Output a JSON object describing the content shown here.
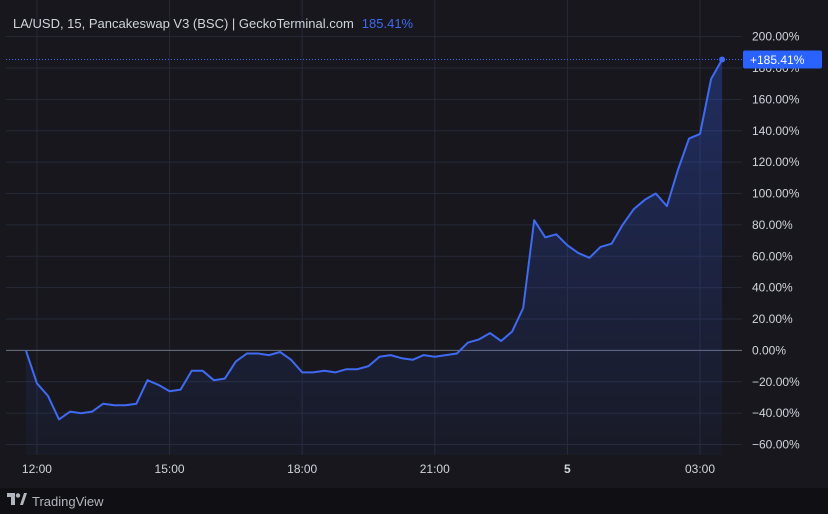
{
  "header": {
    "title": "LA/USD, 15, Pancakeswap V3 (BSC) | GeckoTerminal.com",
    "change": "185.41%"
  },
  "footer": {
    "brand": "TradingView",
    "logo_icon": "tradingview-logo-icon"
  },
  "colors": {
    "background": "#17171d",
    "line": "#3f6af2",
    "grid": "#262a38",
    "text": "#d1d4dc",
    "badge": "#2962ff"
  },
  "chart_data": {
    "type": "area",
    "title": "LA/USD, 15, Pancakeswap V3 (BSC) | GeckoTerminal.com",
    "xlabel": "",
    "ylabel": "",
    "y_unit": "%",
    "ylim": [
      -65,
      205
    ],
    "y_ticks": [
      "200.00%",
      "180.00%",
      "160.00%",
      "140.00%",
      "120.00%",
      "100.00%",
      "80.00%",
      "60.00%",
      "40.00%",
      "20.00%",
      "0.00%",
      "−20.00%",
      "−40.00%",
      "−60.00%"
    ],
    "y_tick_values": [
      200,
      180,
      160,
      140,
      120,
      100,
      80,
      60,
      40,
      20,
      0,
      -20,
      -40,
      -60
    ],
    "x_ticks": [
      {
        "label": "12:00",
        "hour": 12,
        "bold": false
      },
      {
        "label": "15:00",
        "hour": 15,
        "bold": false
      },
      {
        "label": "18:00",
        "hour": 18,
        "bold": false
      },
      {
        "label": "21:00",
        "hour": 21,
        "bold": false
      },
      {
        "label": "5",
        "hour": 24,
        "bold": true
      },
      {
        "label": "03:00",
        "hour": 27,
        "bold": false
      }
    ],
    "grid": true,
    "last_value_label": "+185.41%",
    "series": [
      {
        "x": [
          11.75,
          12.0,
          12.25,
          12.5,
          12.75,
          13.0,
          13.25,
          13.5,
          13.75,
          14.0,
          14.25,
          14.5,
          14.75,
          15.0,
          15.25,
          15.5,
          15.75,
          16.0,
          16.25,
          16.5,
          16.75,
          17.0,
          17.25,
          17.5,
          17.75,
          18.0,
          18.25,
          18.5,
          18.75,
          19.0,
          19.25,
          19.5,
          19.75,
          20.0,
          20.25,
          20.5,
          20.75,
          21.0,
          21.25,
          21.5,
          21.75,
          22.0,
          22.25,
          22.5,
          22.75,
          23.0,
          23.25,
          23.5,
          23.75,
          24.0,
          24.25,
          24.5,
          24.75,
          25.0,
          25.25,
          25.5,
          25.75,
          26.0,
          26.25,
          26.5,
          26.75,
          27.0,
          27.25,
          27.5
        ],
        "y": [
          0,
          -21,
          -29,
          -44,
          -39,
          -40,
          -39,
          -34,
          -35,
          -35,
          -34,
          -19,
          -22,
          -26,
          -25,
          -13,
          -13,
          -19,
          -18,
          -7,
          -2,
          -2,
          -3,
          -1,
          -6,
          -14,
          -14,
          -13,
          -14,
          -12,
          -12,
          -10,
          -4,
          -3,
          -5,
          -6,
          -3,
          -4,
          -3,
          -2,
          5,
          7,
          11,
          6,
          12,
          27,
          83,
          72,
          74,
          67,
          62,
          59,
          66,
          68,
          80,
          90,
          96,
          100,
          92,
          115,
          135,
          138,
          173,
          185.41
        ]
      }
    ]
  }
}
